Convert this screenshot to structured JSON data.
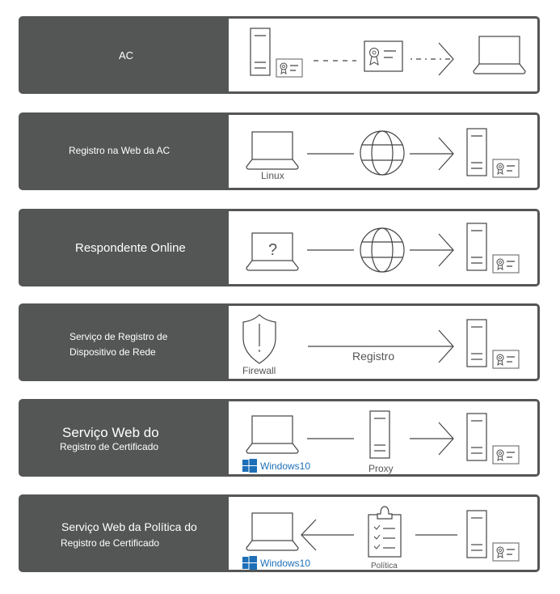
{
  "rows": [
    {
      "title": "AC",
      "flow": "server-with-certificate --dashed--> certificate --dashed arrow--> laptop"
    },
    {
      "title": "Registro na Web da AC",
      "client_label": "Linux",
      "flow": "laptop --- globe --> server-with-certificate"
    },
    {
      "title": "Respondente Online",
      "flow": "laptop-question --- globe --> server-with-certificate"
    },
    {
      "title_line1": "Serviço de Registro de",
      "title_line2": "Dispositivo de Rede",
      "client_label": "Firewall",
      "arrow_label": "Registro",
      "flow": "shield --arrow--> server-with-certificate"
    },
    {
      "title_line1": "Serviço Web do",
      "title_line2": "Registro de Certificado",
      "client_label": "Windows10",
      "middle_label": "Proxy",
      "flow": "laptop --- proxy-server --> server-with-certificate"
    },
    {
      "title_line1": "Serviço Web da Política do",
      "title_line2": "Registro de Certificado",
      "client_label": "Windows10",
      "middle_label": "Política",
      "flow": "laptop <-- policy-clipboard --- server-with-certificate"
    }
  ],
  "colors": {
    "panel": "#545655",
    "icon_stroke": "#555555",
    "windows_blue": "#1e6fb7"
  }
}
